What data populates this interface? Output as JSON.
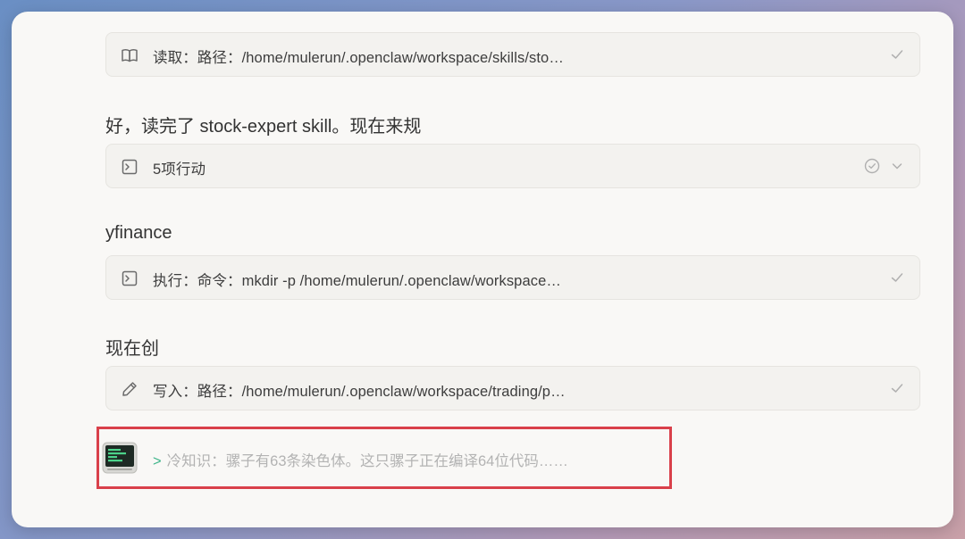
{
  "items": [
    {
      "type": "tool",
      "icon": "book-icon",
      "label": "读取：路径：/home/mulerun/.openclaw/workspace/skills/sto…",
      "status": "check"
    },
    {
      "type": "text",
      "text": "好，读完了 stock-expert skill。现在来规"
    },
    {
      "type": "tool",
      "icon": "terminal-icon",
      "label": "5项行动",
      "status": "check-circle-expand"
    },
    {
      "type": "text",
      "text": "yfinance"
    },
    {
      "type": "tool",
      "icon": "terminal-icon",
      "label": "执行：命令：mkdir -p /home/mulerun/.openclaw/workspace…",
      "status": "check"
    },
    {
      "type": "text",
      "text": "现在创"
    },
    {
      "type": "tool",
      "icon": "pencil-icon",
      "label": "写入：路径：/home/mulerun/.openclaw/workspace/trading/p…",
      "status": "check"
    }
  ],
  "tip": {
    "prompt": ">",
    "text": "冷知识：骡子有63条染色体。这只骡子正在编译64位代码……",
    "highlight_color": "#d9404a"
  }
}
